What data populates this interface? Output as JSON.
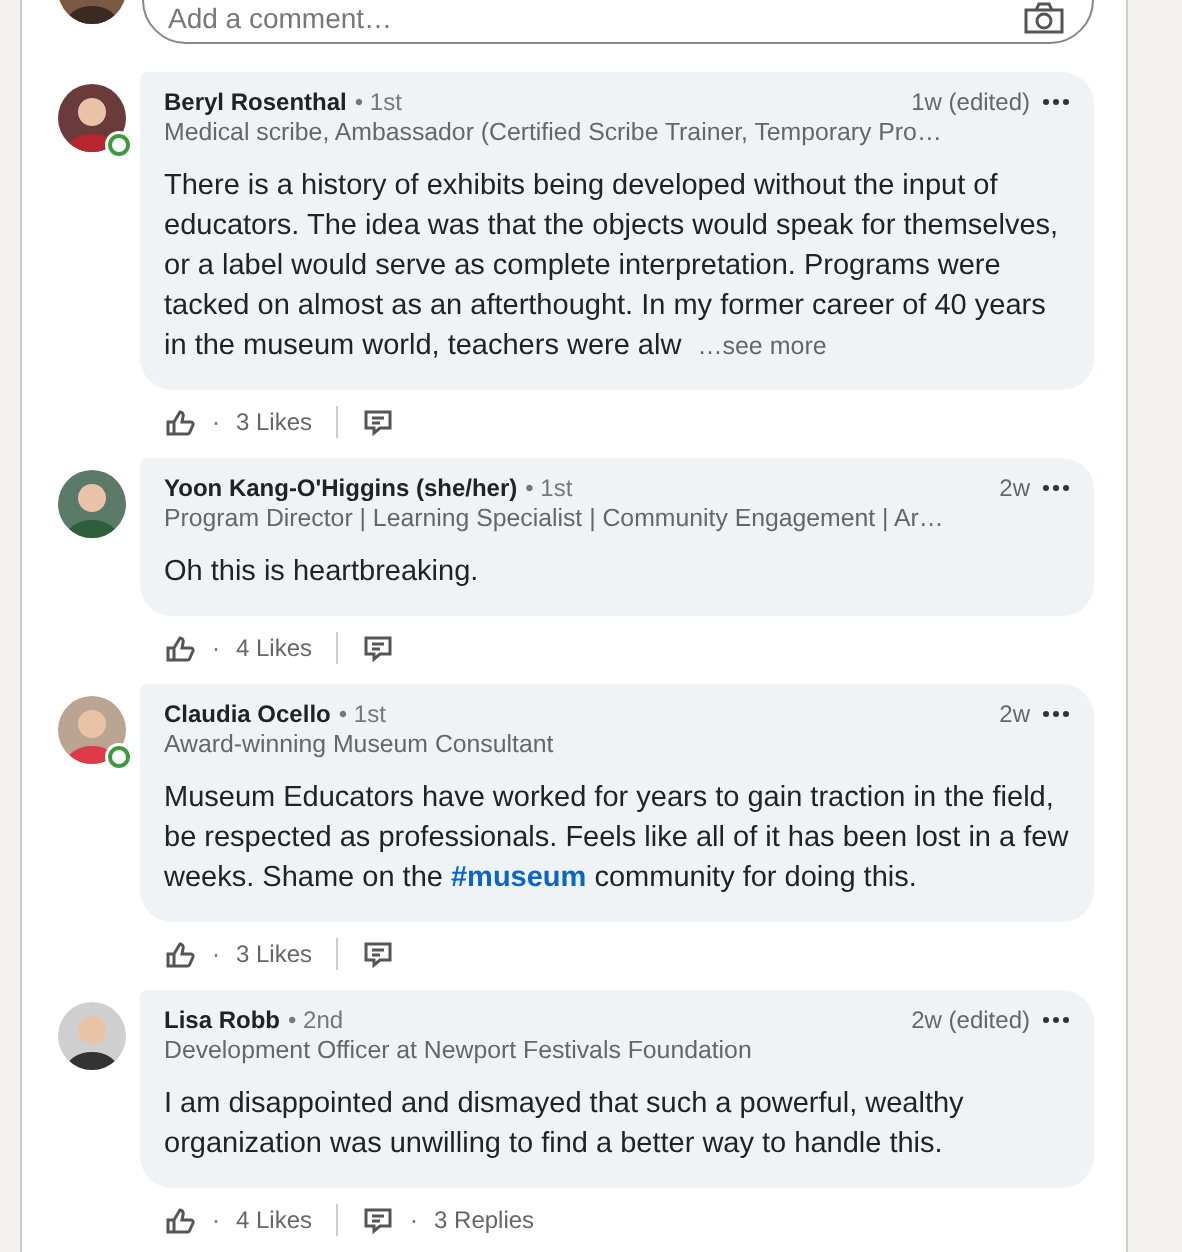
{
  "composer": {
    "placeholder": "Add a comment…"
  },
  "comments": [
    {
      "name": "Beryl Rosenthal",
      "degree": "• 1st",
      "headline": "Medical scribe, Ambassador (Certified Scribe Trainer, Temporary Pro…",
      "time": "1w (edited)",
      "online": true,
      "body": [
        {
          "kind": "text",
          "text": "There is a history of exhibits being developed without the input of educators. The idea was that the objects would speak for themselves, or a label would serve as complete interpretation. Programs were tacked on almost as an afterthought. In my former career of 40 years in the museum world, teachers were alw"
        }
      ],
      "see_more": "…see more",
      "likes_dot": "·",
      "likes": "3 Likes"
    },
    {
      "name": "Yoon Kang-O'Higgins (she/her)",
      "degree": "• 1st",
      "headline": "Program Director | Learning Specialist | Community Engagement | Ar…",
      "time": "2w",
      "online": false,
      "body": [
        {
          "kind": "text",
          "text": "Oh this is heartbreaking."
        }
      ],
      "likes_dot": "·",
      "likes": "4 Likes"
    },
    {
      "name": "Claudia Ocello",
      "degree": "• 1st",
      "headline": "Award-winning Museum Consultant",
      "time": "2w",
      "online": true,
      "body": [
        {
          "kind": "text",
          "text": "Museum Educators have worked for years to gain traction in the field, be respected as professionals. Feels like all of it has been lost in a few weeks. Shame on the "
        },
        {
          "kind": "hashtag",
          "text": "#museum"
        },
        {
          "kind": "text",
          "text": " community for doing this."
        }
      ],
      "likes_dot": "·",
      "likes": "3 Likes"
    },
    {
      "name": "Lisa Robb",
      "degree": "• 2nd",
      "headline": "Development Officer at Newport Festivals Foundation",
      "time": "2w (edited)",
      "online": false,
      "body": [
        {
          "kind": "text",
          "text": "I am disappointed and dismayed that such a powerful, wealthy organization was unwilling to find a better way to handle this."
        }
      ],
      "likes_dot": "·",
      "likes": "4 Likes",
      "replies_dot": "·",
      "replies": "3 Replies"
    }
  ]
}
